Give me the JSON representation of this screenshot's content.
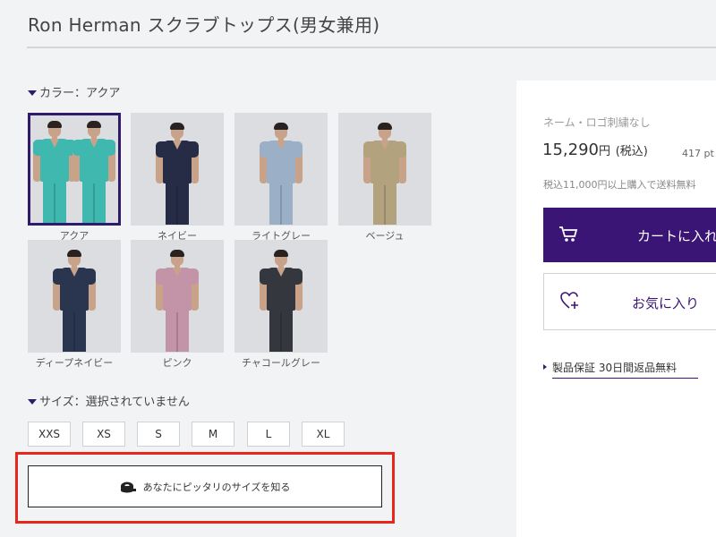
{
  "product": {
    "title": "Ron Herman スクラブトップス(男女兼用)"
  },
  "color": {
    "label": "カラー：アクア",
    "swatches": [
      {
        "name": "アクア",
        "selected": true,
        "color": "#3fb8b0"
      },
      {
        "name": "ネイビー",
        "selected": false,
        "color": "#262c45"
      },
      {
        "name": "ライトグレー",
        "selected": false,
        "color": "#9bb0c6"
      },
      {
        "name": "ベージュ",
        "selected": false,
        "color": "#b2a27d"
      },
      {
        "name": "ディープネイビー",
        "selected": false,
        "color": "#2a3550"
      },
      {
        "name": "ピンク",
        "selected": false,
        "color": "#c393a8"
      },
      {
        "name": "チャコールグレー",
        "selected": false,
        "color": "#34383e"
      }
    ]
  },
  "size": {
    "label": "サイズ：選択されていません",
    "options": [
      "XXS",
      "XS",
      "S",
      "M",
      "L",
      "XL"
    ]
  },
  "fit_button": {
    "label": "あなたにピッタリのサイズを知る",
    "icon": "measuring-tape-icon"
  },
  "purchase": {
    "note": "ネーム・ロゴ刺繍なし",
    "price": "15,290",
    "price_unit": "円",
    "tax_label": "(税込)",
    "points": "417 pt",
    "shipping": "税込11,000円以上購入で送料無料",
    "cart_label": "カートに入れる",
    "cart_icon": "cart-icon",
    "favorite_label": "お気に入り",
    "favorite_icon": "heart-plus-icon",
    "guarantee": "製品保証 30日間返品無料"
  },
  "colors": {
    "accent": "#3b1575",
    "highlight": "#e8261c",
    "background": "#f2f3f5"
  }
}
